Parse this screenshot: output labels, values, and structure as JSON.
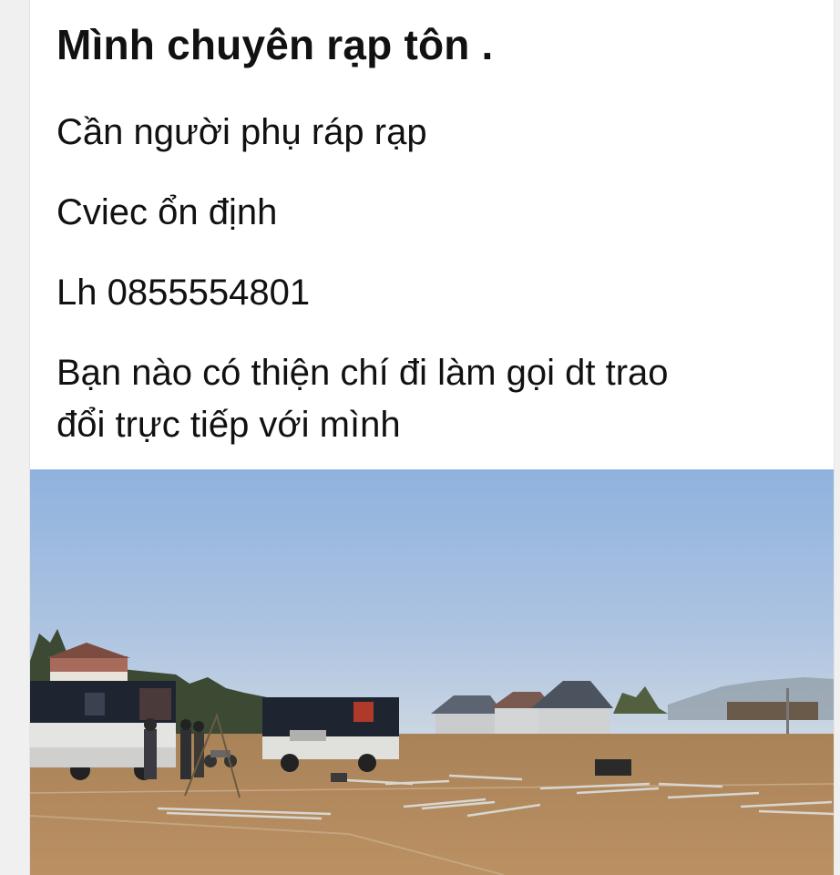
{
  "post": {
    "title": "Mình chuyên rạp tôn .",
    "lines": [
      "Cần người phụ ráp rạp",
      "Cviec ổn định",
      "Lh 0855554801",
      "Bạn nào có thiện chí đi làm gọi dt trao",
      "đổi trực tiếp với mình"
    ]
  },
  "photo": {
    "colors": {
      "sky_top": "#8fb2de",
      "sky_bottom": "#c9d6e4",
      "ground": "#b38a5a",
      "truck_cover": "#1f2530",
      "truck_body": "#e4e4e2"
    }
  }
}
